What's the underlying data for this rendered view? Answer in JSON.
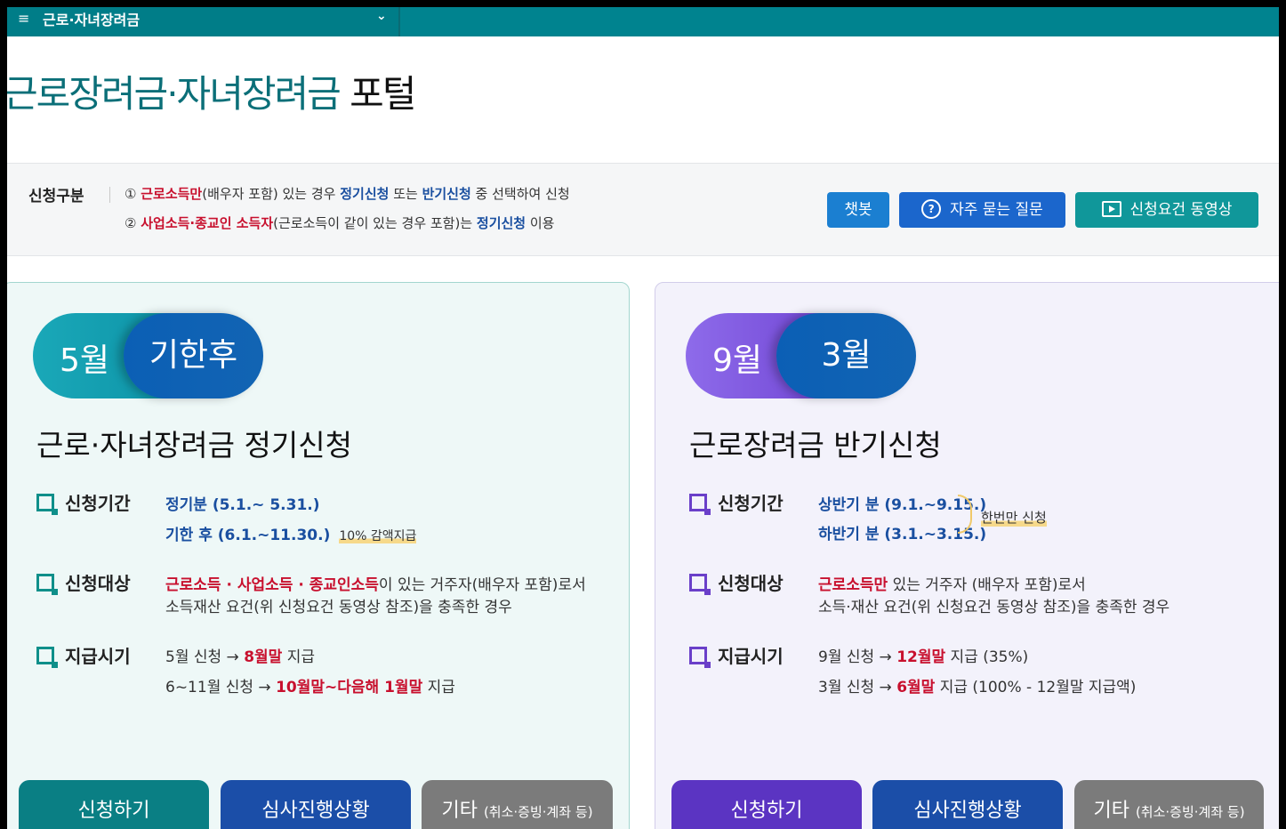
{
  "topbar": {
    "menu_icon": "≡",
    "menu_label": "근로·자녀장려금",
    "chevron": "⌄"
  },
  "page_title": {
    "accent": "근로장려금·자녀장려금",
    "rest": " 포털"
  },
  "info": {
    "label": "신청구분",
    "line1": {
      "num": "①",
      "red": "근로소득만",
      "t1": "(배우자 포함) 있는 경우 ",
      "blue1": "정기신청",
      "t2": " 또는 ",
      "blue2": "반기신청",
      "t3": " 중 선택하여 신청"
    },
    "line2": {
      "num": "②",
      "red": "사업소득·종교인 소득자",
      "t1": "(근로소득이 같이 있는 경우 포함)는 ",
      "blue1": "정기신청",
      "t2": " 이용"
    }
  },
  "buttons": {
    "chatbot": "챗봇",
    "faq": "자주 묻는 질문",
    "video": "신청요건 동영상"
  },
  "icons": {
    "faq": "question-circle-icon",
    "video": "play-icon"
  },
  "left_card": {
    "pill_a": "5월",
    "pill_b": "기한후",
    "title": "근로·자녀장려금 정기신청",
    "period_label": "신청기간",
    "period_1": "정기분 (5.1.~ 5.31.)",
    "period_2": "기한 후 (6.1.~11.30.)",
    "period_2_note": "10% 감액지급",
    "target_label": "신청대상",
    "target_red": "근로소득 · 사업소득 · 종교인소득",
    "target_t1": "이 있는 거주자(배우자 포함)로서",
    "target_t2": "소득재산 요건(위 신청요건 동영상 참조)을 충족한 경우",
    "pay_label": "지급시기",
    "pay1_a": "5월 신청 → ",
    "pay1_red": "8월말",
    "pay1_b": " 지급",
    "pay2_a": "6~11월 신청 → ",
    "pay2_red": "10월말~다음해 1월말",
    "pay2_b": " 지급",
    "btn_apply": "신청하기",
    "btn_status": "심사진행상황",
    "btn_etc": "기타",
    "btn_etc_sub": "(취소·증빙·계좌 등)"
  },
  "right_card": {
    "pill_a": "9월",
    "pill_b": "3월",
    "title": "근로장려금 반기신청",
    "period_label": "신청기간",
    "period_1": "상반기 분 (9.1.~9.15.)",
    "period_2": "하반기 분 (3.1.~3.15.)",
    "once": "한번만 신청",
    "target_label": "신청대상",
    "target_red": "근로소득만",
    "target_t1": " 있는 거주자 (배우자 포함)로서",
    "target_t2": "소득·재산 요건(위 신청요건 동영상 참조)을 충족한 경우",
    "pay_label": "지급시기",
    "pay1_a": "9월 신청 → ",
    "pay1_red": "12월말",
    "pay1_b": " 지급 (35%)",
    "pay2_a": "3월 신청 → ",
    "pay2_red": "6월말",
    "pay2_b": " 지급 (100% - 12월말 지급액)",
    "btn_apply": "신청하기",
    "btn_status": "심사진행상황",
    "btn_etc": "기타",
    "btn_etc_sub": "(취소·증빙·계좌 등)"
  },
  "colors": {
    "teal": "#00838f",
    "purple": "#5b34c2",
    "blue": "#1b4ea8",
    "red": "#c8102e"
  }
}
